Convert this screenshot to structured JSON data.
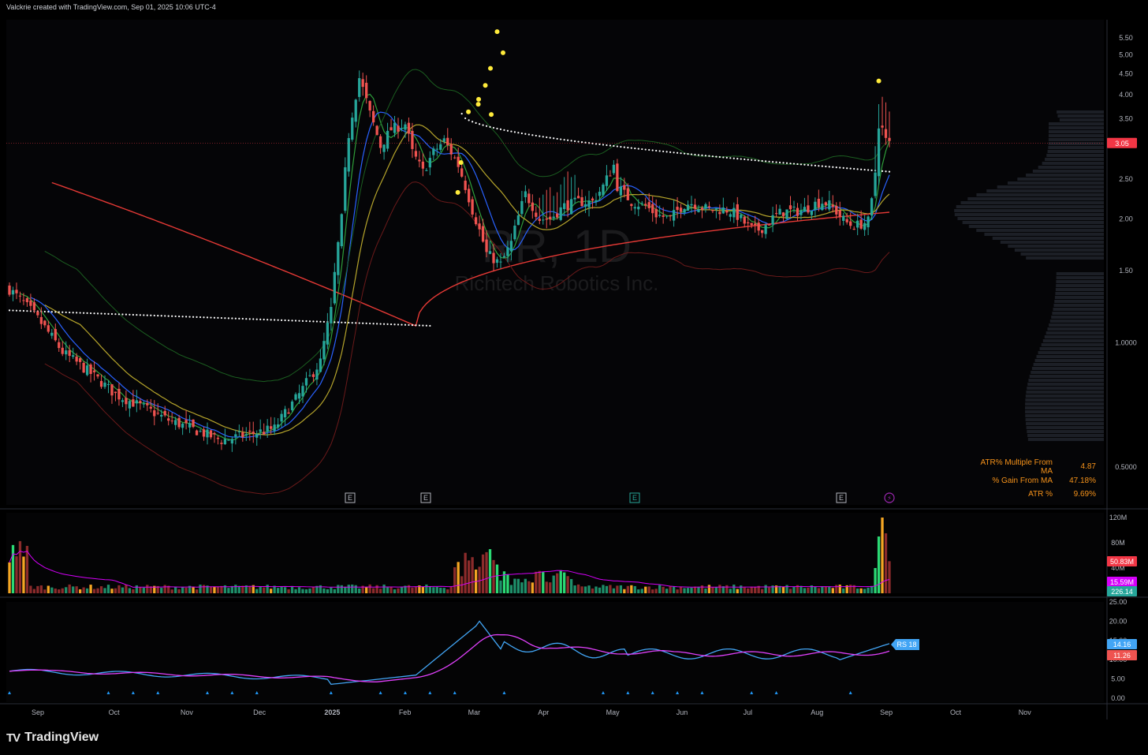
{
  "header": {
    "attribution": "Valckrie created with TradingView.com, Sep 01, 2025 10:06 UTC-4"
  },
  "brand": {
    "logo_text": "TV",
    "name": "TradingView"
  },
  "watermark": {
    "symbol": "RR, 1D",
    "company": "Richtech Robotics Inc."
  },
  "stats": [
    {
      "label": "ATR% Multiple From MA",
      "value": "4.87"
    },
    {
      "label": "% Gain From MA",
      "value": "47.18%"
    },
    {
      "label": "ATR %",
      "value": "9.69%"
    }
  ],
  "colors": {
    "background": "#000000",
    "up": "#26a69a",
    "down": "#ef5350",
    "ma_red": "#e53935",
    "ma_yellow": "#b5a42b",
    "ma_green": "#2e9e3a",
    "ma_blue": "#2962ff",
    "rs_line": "#42a5f5",
    "rs_ma": "#e040fb",
    "vol_ma": "#d500f9",
    "pivot_dots": "#ffeb3b",
    "last_price": "#f23645"
  },
  "chart_data": [
    {
      "type": "candlestick",
      "title": "RR, 1D",
      "subtitle": "Richtech Robotics Inc.",
      "y_axis_ticks": [
        "5.50",
        "5.00",
        "4.50",
        "4.00",
        "3.50",
        "3.05",
        "2.50",
        "2.00",
        "1.50",
        "1.0000",
        "0.5000"
      ],
      "y_scale": "log",
      "ylim": [
        0.5,
        5.5
      ],
      "last_price": "3.05",
      "x_axis_labels": [
        "Sep",
        "Oct",
        "Nov",
        "Dec",
        "2025",
        "Feb",
        "Mar",
        "Apr",
        "May",
        "Jun",
        "Jul",
        "Aug",
        "Sep",
        "Oct",
        "Nov"
      ],
      "earnings_markers": [
        "E",
        "E",
        "E",
        "E"
      ],
      "pivot_highs": [
        5.4,
        4.8,
        4.4,
        4.0,
        3.7,
        3.6,
        3.4,
        3.45,
        2.6,
        2.2,
        4.1
      ],
      "series_summary": [
        {
          "period": "Sep-Nov 2024",
          "range": [
            0.55,
            1.6
          ]
        },
        {
          "period": "Dec 2024",
          "range": [
            0.8,
            2.2
          ]
        },
        {
          "period": "Jan 2025",
          "range": [
            2.5,
            5.2
          ]
        },
        {
          "period": "Feb 2025",
          "range": [
            2.5,
            3.4
          ]
        },
        {
          "period": "Mar 2025",
          "range": [
            1.45,
            2.5
          ]
        },
        {
          "period": "Apr-May 2025",
          "range": [
            1.9,
            2.9
          ]
        },
        {
          "period": "Jun-Aug 2025",
          "range": [
            1.75,
            2.3
          ]
        },
        {
          "period": "late Aug 2025",
          "range": [
            2.0,
            3.9
          ]
        }
      ],
      "moving_averages": [
        {
          "color": "#e53935",
          "start": 2.45,
          "low": 1.1,
          "end": 2.08
        },
        {
          "color": "#ffffff",
          "style": "dotted",
          "start": 1.2,
          "mid": 3.3,
          "end": 2.6
        }
      ]
    },
    {
      "type": "bar",
      "title": "Volume",
      "y_axis_ticks": [
        "120M",
        "80M",
        "40M"
      ],
      "labels": [
        "50.83M",
        "15.59M",
        "226.14"
      ],
      "label_colors": [
        "#f23645",
        "#d500f9",
        "#26a69a"
      ],
      "peak_value": 120
    },
    {
      "type": "line",
      "title": "RS",
      "y_axis_ticks": [
        "25.00",
        "20.00",
        "15.00",
        "10.00",
        "5.00",
        "0.00"
      ],
      "series": [
        {
          "name": "RS 18",
          "last": "14.16",
          "color": "#42a5f5"
        },
        {
          "last": "11.26",
          "color": "#e040fb"
        }
      ],
      "peak_value": 21
    }
  ]
}
